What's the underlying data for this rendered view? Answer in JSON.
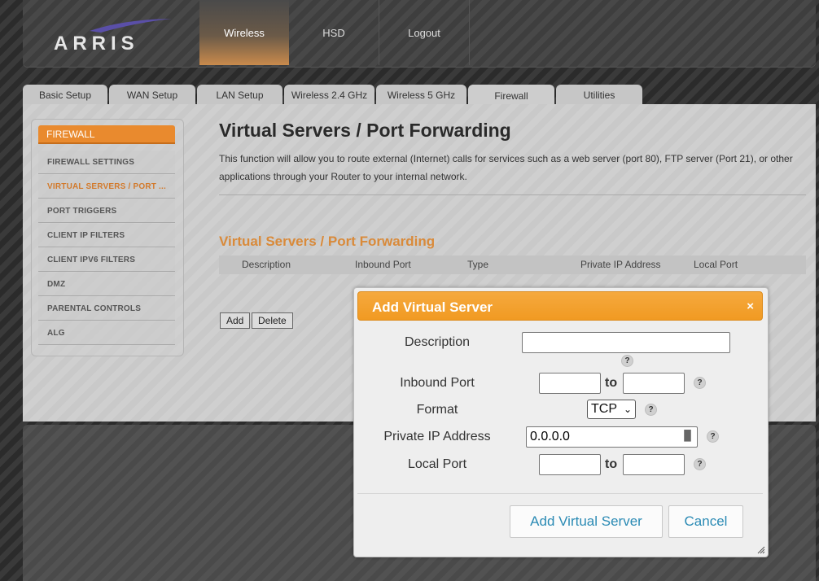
{
  "header": {
    "logo_text": "ARRIS",
    "nav": [
      {
        "label": "Wireless",
        "active": true
      },
      {
        "label": "HSD",
        "active": false
      },
      {
        "label": "Logout",
        "active": false
      }
    ]
  },
  "tabs": [
    {
      "label": "Basic Setup",
      "width": 104
    },
    {
      "label": "WAN Setup",
      "width": 106
    },
    {
      "label": "LAN Setup",
      "width": 105
    },
    {
      "label": "Wireless 2.4 GHz",
      "width": 111
    },
    {
      "label": "Wireless 5 GHz",
      "width": 111
    },
    {
      "label": "Firewall",
      "width": 106,
      "active": true
    },
    {
      "label": "Utilities",
      "width": 106
    }
  ],
  "sidebar": {
    "header": "FIREWALL",
    "items": [
      {
        "label": "FIREWALL SETTINGS"
      },
      {
        "label": "VIRTUAL SERVERS / PORT ...",
        "active": true
      },
      {
        "label": "PORT TRIGGERS"
      },
      {
        "label": "CLIENT IP FILTERS"
      },
      {
        "label": "CLIENT IPV6 FILTERS"
      },
      {
        "label": "DMZ"
      },
      {
        "label": "PARENTAL CONTROLS"
      },
      {
        "label": "ALG"
      }
    ]
  },
  "content": {
    "title": "Virtual Servers / Port Forwarding",
    "description": "This function will allow you to route external (Internet) calls for services such as a web server (port 80), FTP server (Port 21), or other applications through your Router to your internal network.",
    "section_title": "Virtual Servers / Port Forwarding",
    "table_headers": [
      "Description",
      "Inbound Port",
      "Type",
      "Private IP Address",
      "Local Port"
    ],
    "add_label": "Add",
    "delete_label": "Delete"
  },
  "modal": {
    "title": "Add Virtual Server",
    "close_symbol": "×",
    "fields": {
      "description_label": "Description",
      "description_value": "",
      "inbound_port_label": "Inbound Port",
      "inbound_from": "",
      "inbound_to": "",
      "to_label": "to",
      "format_label": "Format",
      "format_value": "TCP",
      "private_ip_label": "Private IP Address",
      "private_ip_value": "0.0.0.0",
      "local_port_label": "Local Port",
      "local_from": "",
      "local_to": ""
    },
    "help_symbol": "?",
    "submit_label": "Add Virtual Server",
    "cancel_label": "Cancel"
  },
  "colors": {
    "accent_orange": "#f19a22",
    "sidebar_active": "#d27a2c",
    "section_title": "#d98a3a",
    "link_blue": "#2a8ab4"
  }
}
